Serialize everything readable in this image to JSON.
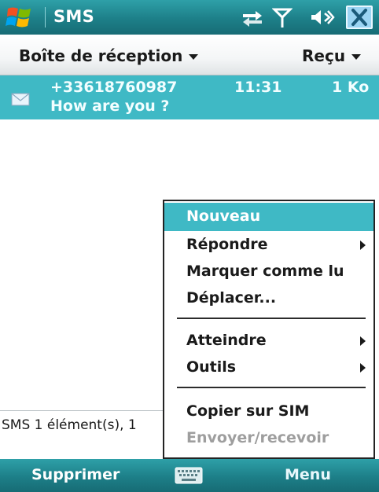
{
  "title_bar": {
    "app_title": "SMS",
    "icons": [
      "windows-start-icon",
      "connectivity-icon",
      "signal-icon",
      "volume-icon",
      "close-icon"
    ]
  },
  "header": {
    "folder_label": "Boîte de réception",
    "sort_label": "Reçu"
  },
  "messages": [
    {
      "sender": "+33618760987",
      "time": "11:31",
      "size": "1 Ko",
      "preview": "How are you ?",
      "icon": "envelope-icon"
    }
  ],
  "status_line": "SMS  1 élément(s), 1",
  "context_menu": {
    "items": [
      {
        "label": "Nouveau",
        "highlighted": true,
        "submenu": false,
        "enabled": true
      },
      {
        "label": "Répondre",
        "highlighted": false,
        "submenu": true,
        "enabled": true
      },
      {
        "label": "Marquer comme lu",
        "highlighted": false,
        "submenu": false,
        "enabled": true
      },
      {
        "label": "Déplacer...",
        "highlighted": false,
        "submenu": false,
        "enabled": true
      },
      {
        "label": "Atteindre",
        "highlighted": false,
        "submenu": true,
        "enabled": true
      },
      {
        "label": "Outils",
        "highlighted": false,
        "submenu": true,
        "enabled": true
      },
      {
        "label": "Copier sur SIM",
        "highlighted": false,
        "submenu": false,
        "enabled": true
      },
      {
        "label": "Envoyer/recevoir",
        "highlighted": false,
        "submenu": false,
        "enabled": false
      }
    ]
  },
  "bottom_bar": {
    "left_softkey": "Supprimer",
    "right_softkey": "Menu",
    "center_icon": "keyboard-icon"
  },
  "colors": {
    "accent": "#3fb9c5",
    "titlebar": "#1d7f88",
    "disabled_text": "#9e9e9e"
  }
}
